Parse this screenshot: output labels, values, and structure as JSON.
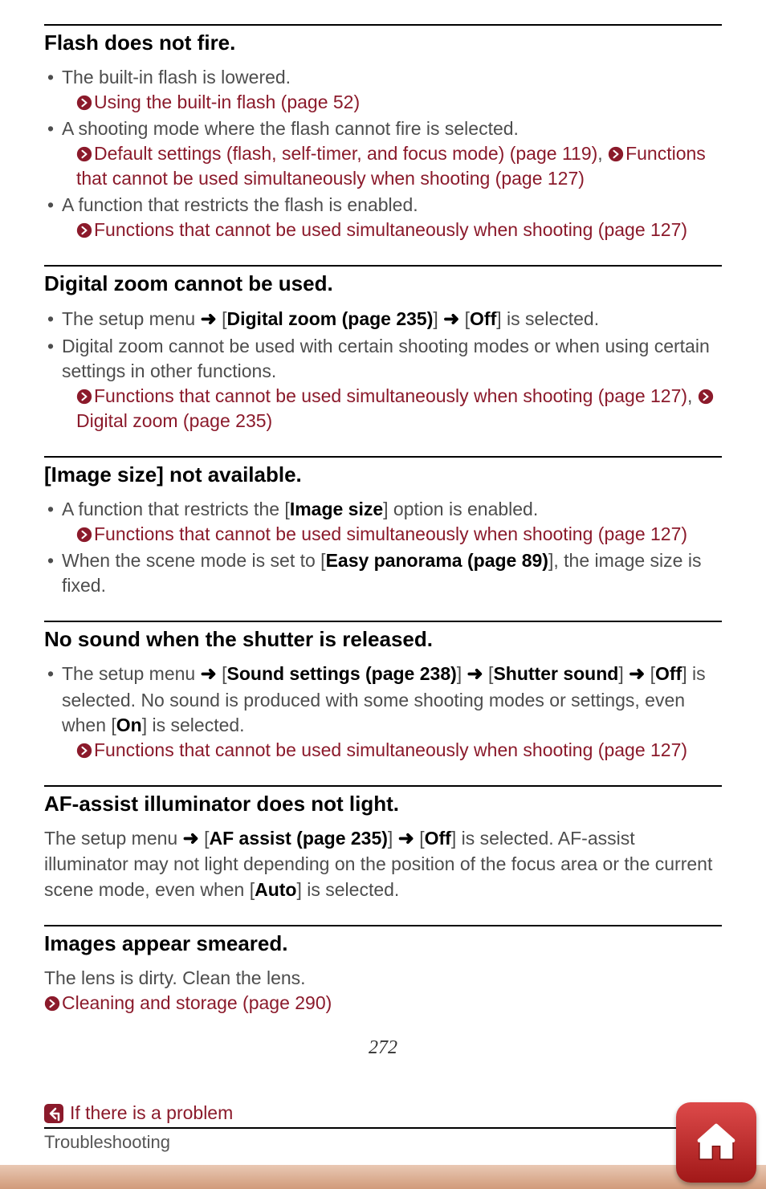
{
  "sections": [
    {
      "heading": "Flash does not fire.",
      "items": [
        {
          "text": "The built-in flash is lowered.",
          "subs": [
            {
              "link": "Using the built-in flash (page 52)"
            }
          ]
        },
        {
          "text": "A shooting mode where the flash cannot fire is selected.",
          "subs": [
            {
              "link": "Default settings (flash, self-timer, and focus mode) (page 119)",
              "sep": ", ",
              "link2": "Functions that cannot be used simultaneously when shooting (page 127)"
            }
          ]
        },
        {
          "text": "A function that restricts the flash is enabled.",
          "subs": [
            {
              "link": "Functions that cannot be used simultaneously when shooting (page 127)"
            }
          ]
        }
      ]
    },
    {
      "heading": "Digital zoom cannot be used.",
      "items": [
        {
          "prefix": "The setup menu ",
          "arrow1": true,
          "br1o": "[",
          "bold1": "Digital zoom (page 235)",
          "br1c": "] ",
          "arrow2": true,
          "br2o": " [",
          "bold2": "Off",
          "br2c": "]",
          "tail": " is selected."
        },
        {
          "text": "Digital zoom cannot be used with certain shooting modes or when using certain settings in other functions.",
          "subs": [
            {
              "link": "Functions that cannot be used simultaneously when shooting (page 127)",
              "sep": ", ",
              "icon2only": true,
              "linktail": "Digital zoom (page 235)"
            }
          ]
        }
      ]
    },
    {
      "heading": "[Image size] not available.",
      "items": [
        {
          "prefix": "A function that restricts the [",
          "bold1": "Image size",
          "tail": "] option is enabled.",
          "subs": [
            {
              "link": "Functions that cannot be used simultaneously when shooting (page 127)"
            }
          ]
        },
        {
          "prefix": "When the scene mode is set to [",
          "bold1": "Easy panorama (page 89)",
          "tail": "], the image size is fixed."
        }
      ]
    },
    {
      "heading": "No sound when the shutter is released.",
      "items": [
        {
          "prefix": "The setup menu ",
          "arrow1": true,
          "br1o": "[",
          "bold1": "Sound settings (page 238)",
          "br1c": "] ",
          "arrow2": true,
          "br2o": " [",
          "bold2": "Shutter sound",
          "br2c": "] ",
          "arrow3": true,
          "br3o": " [",
          "bold3": "Off",
          "br3c": "]",
          "tail": " is selected. No sound is produced with some shooting modes or settings, even when [",
          "tailbold": "On",
          "tail2": "] is selected.",
          "subs": [
            {
              "link": "Functions that cannot be used simultaneously when shooting (page 127)"
            }
          ]
        }
      ]
    },
    {
      "heading": "AF-assist illuminator does not light.",
      "para": {
        "prefix": "The setup menu ",
        "arrow1": true,
        "br1o": "[",
        "bold1": "AF assist (page 235)",
        "br1c": "] ",
        "arrow2": true,
        "br2o": " [",
        "bold2": "Off",
        "br2c": "]",
        "tail": " is selected. AF-assist illuminator may not light depending on the position of the focus area or the current scene mode, even when [",
        "tailbold": "Auto",
        "tail2": "] is selected."
      }
    },
    {
      "heading": "Images appear smeared.",
      "para": {
        "plain": "The lens is dirty. Clean the lens.",
        "linksub": "Cleaning and storage (page 290)"
      }
    }
  ],
  "page_number": "272",
  "footer": {
    "chapter": "If there is a problem",
    "section": "Troubleshooting"
  }
}
